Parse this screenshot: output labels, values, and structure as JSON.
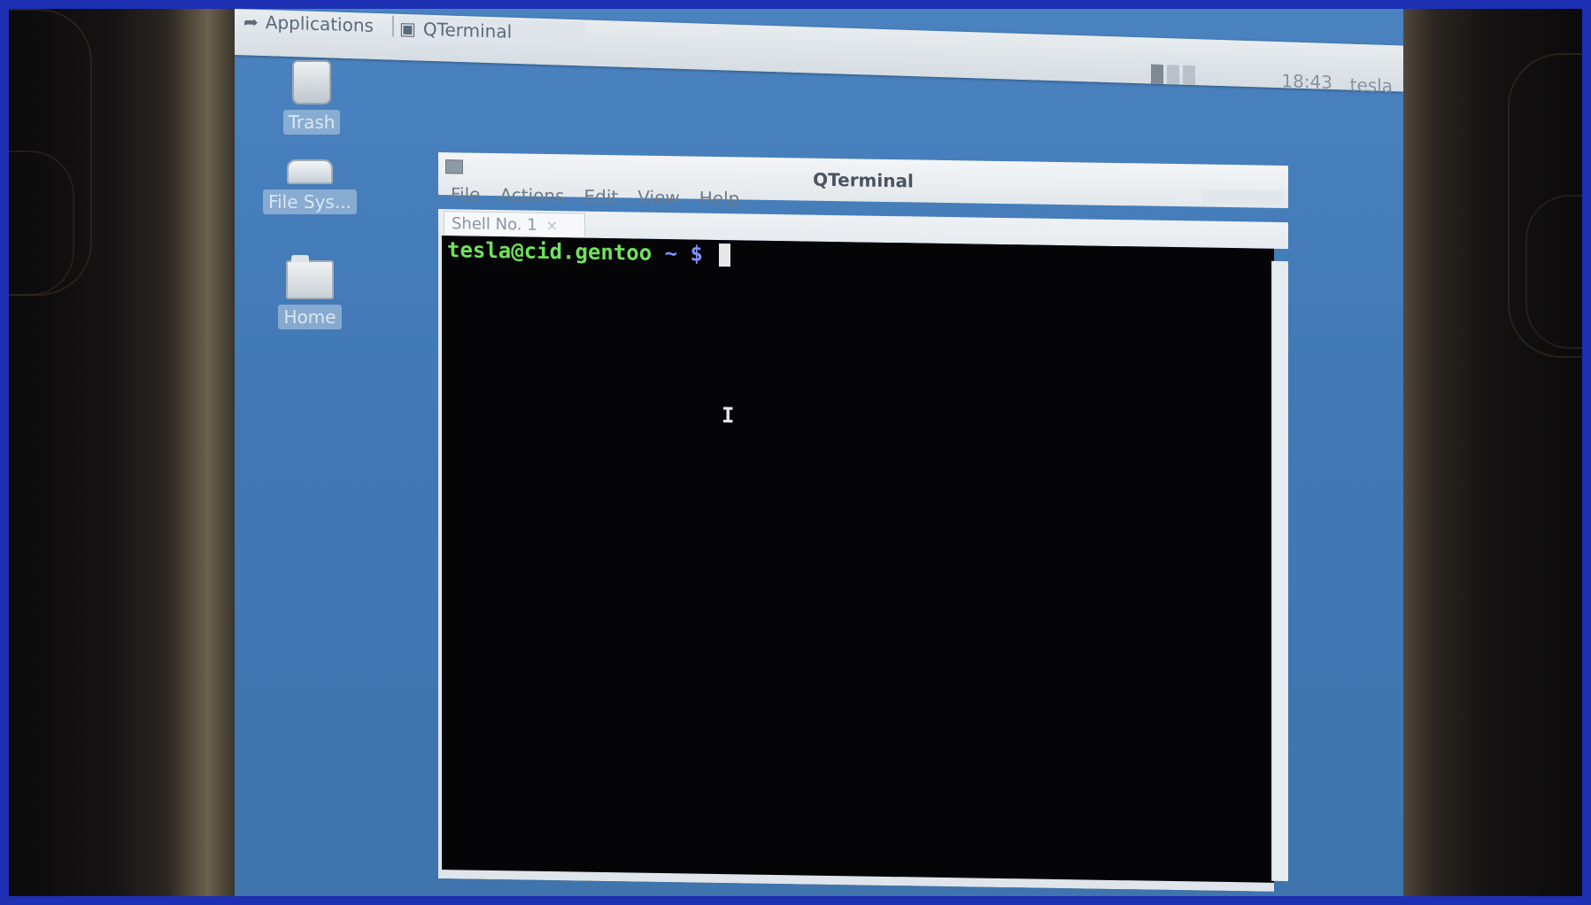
{
  "panel": {
    "applications_label": "Applications",
    "task_label": "QTerminal",
    "clock": "18:43",
    "user": "tesla"
  },
  "desktop": {
    "icons": [
      {
        "label": "Trash"
      },
      {
        "label": "File Sys..."
      },
      {
        "label": "Home"
      }
    ]
  },
  "window": {
    "title": "QTerminal",
    "menu": [
      "File",
      "Actions",
      "Edit",
      "View",
      "Help"
    ],
    "tab_label": "Shell No. 1",
    "tab_close": "×",
    "prompt_user": "tesla@cid.gentoo",
    "prompt_path": " ~ $ "
  },
  "colors": {
    "desktop": "#4279b6",
    "terminal_bg": "#050406",
    "prompt_user": "#6fe35c",
    "prompt_path": "#7f93ff"
  }
}
